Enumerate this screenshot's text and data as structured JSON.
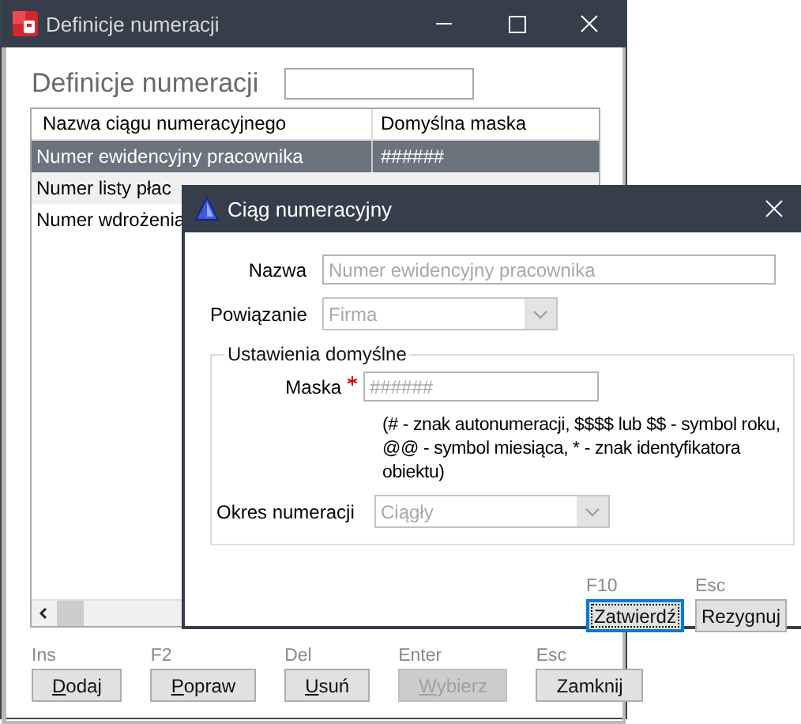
{
  "window": {
    "title": "Definicje numeracji"
  },
  "heading": "Definicje numeracji",
  "table": {
    "columns": [
      "Nazwa ciągu numeracyjnego",
      "Domyślna maska"
    ],
    "rows": [
      {
        "cells": [
          "Numer ewidencyjny pracownika",
          "######"
        ],
        "selected": true
      },
      {
        "cells": [
          "Numer listy płac"
        ],
        "selected": false
      },
      {
        "cells": [
          "Numer wdrożenia"
        ],
        "selected": false
      }
    ]
  },
  "buttons": [
    {
      "shortcut": "Ins",
      "label": "Dodaj",
      "mnemonic": true,
      "disabled": false
    },
    {
      "shortcut": "F2",
      "label": "Popraw",
      "mnemonic": true,
      "disabled": false
    },
    {
      "shortcut": "Del",
      "label": "Usuń",
      "mnemonic": true,
      "disabled": false
    },
    {
      "shortcut": "Enter",
      "label": "Wybierz",
      "mnemonic": true,
      "disabled": true
    },
    {
      "shortcut": "Esc",
      "label": "Zamknij",
      "mnemonic": false,
      "disabled": false
    }
  ],
  "dialog": {
    "title": "Ciąg numeracyjny",
    "name": {
      "label": "Nazwa",
      "value": "Numer ewidencyjny pracownika"
    },
    "binding": {
      "label": "Powiązanie",
      "value": "Firma"
    },
    "group": {
      "title": "Ustawienia domyślne",
      "mask": {
        "label": "Maska",
        "required": true,
        "placeholder": "######"
      },
      "help": "(# - znak autonumeracji, $$$$ lub $$ - symbol roku, @@ - symbol miesiąca, * - znak identyfikatora obiektu)",
      "period": {
        "label": "Okres numeracji",
        "value": "Ciągły"
      }
    },
    "buttons": [
      {
        "shortcut": "F10",
        "label": "Zatwierdź",
        "focused": true
      },
      {
        "shortcut": "Esc",
        "label": "Rezygnuj",
        "focused": false
      }
    ]
  }
}
